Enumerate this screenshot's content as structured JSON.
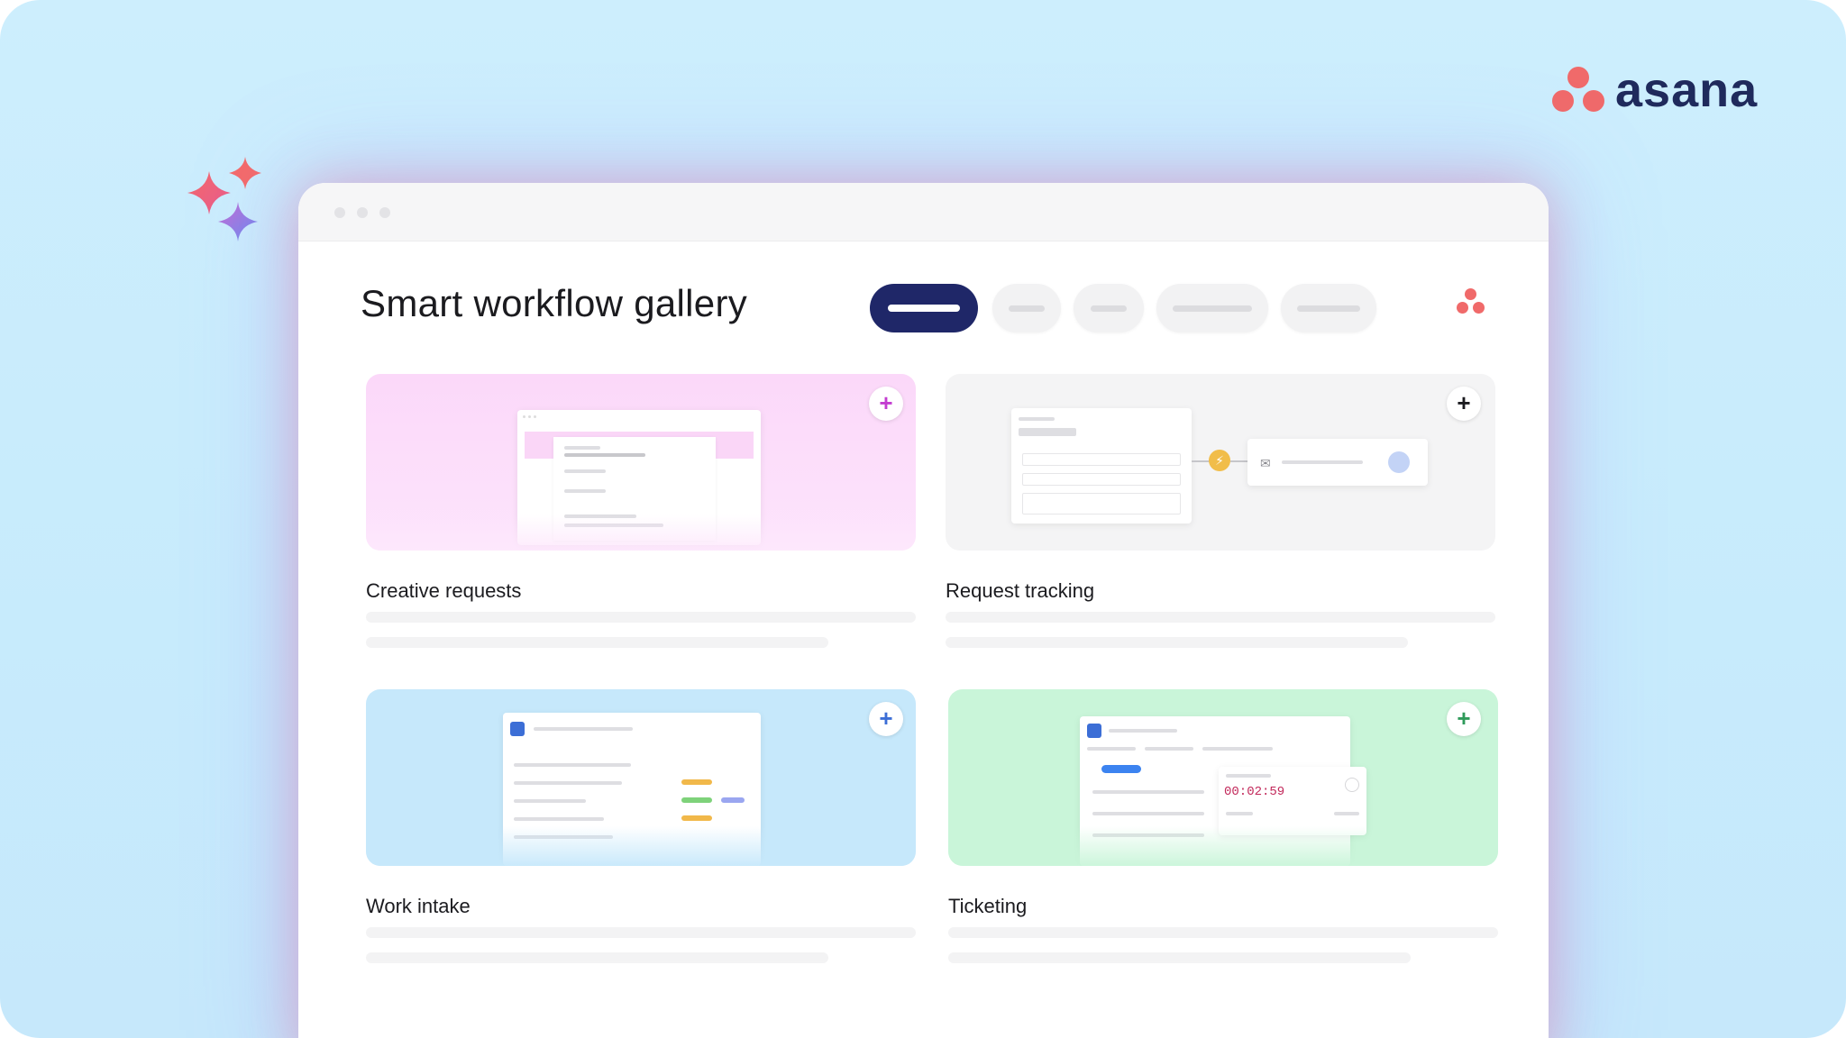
{
  "brand": {
    "name": "asana",
    "color": "#f06a6a",
    "text_color": "#1f2a5c"
  },
  "page": {
    "title": "Smart workflow gallery"
  },
  "filters": {
    "active_index": 0,
    "count": 5,
    "active_color": "#1f2768"
  },
  "cards": [
    {
      "title": "Creative requests",
      "thumb_color": "#fcdcfb",
      "plus_color": "#c33dd0",
      "icon": "plus-icon"
    },
    {
      "title": "Request tracking",
      "thumb_color": "#f4f4f5",
      "plus_color": "#1b1b1f",
      "icon": "plus-icon"
    },
    {
      "title": "Work intake",
      "thumb_color": "#c6e8fb",
      "plus_color": "#3c6ed6",
      "icon": "plus-icon"
    },
    {
      "title": "Ticketing",
      "thumb_color": "#c9f5d9",
      "plus_color": "#2f9a5a",
      "icon": "plus-icon"
    }
  ],
  "ticketing_preview": {
    "timer": "00:02:59"
  }
}
